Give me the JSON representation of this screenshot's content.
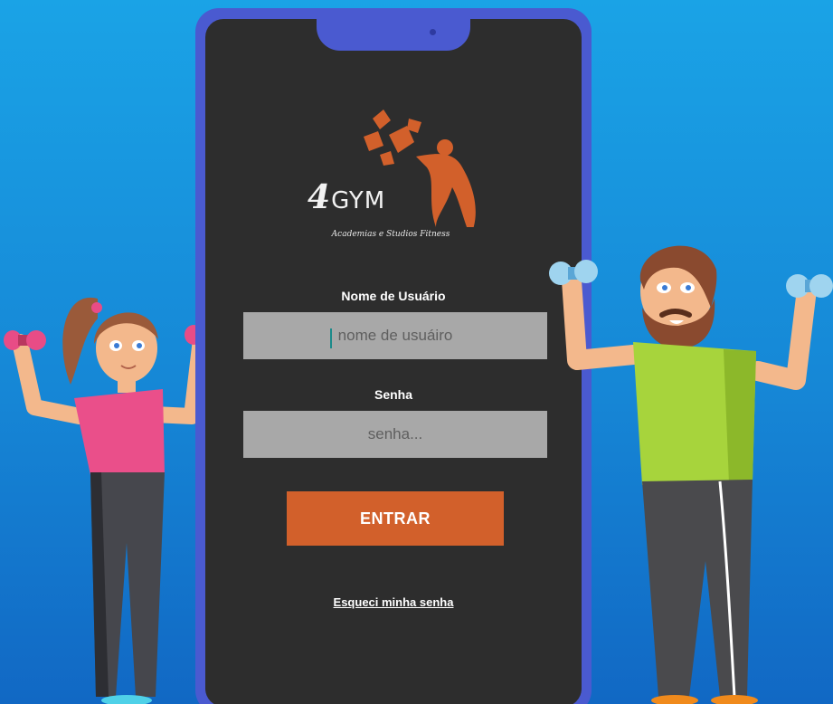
{
  "brand": {
    "logo_word": "GYM",
    "logo_number": "4",
    "tagline": "Academias e Studios Fitness",
    "accent_color": "#d2602b"
  },
  "login_form": {
    "username_label": "Nome de Usuário",
    "username_placeholder": "nome de usuáiro",
    "password_label": "Senha",
    "password_placeholder": "senha...",
    "submit_label": "ENTRAR",
    "forgot_password_link": "Esqueci minha senha"
  },
  "colors": {
    "background_top": "#1aa3e6",
    "background_bottom": "#1168c4",
    "phone_frame": "#4a5ad0",
    "screen": "#2d2d2d",
    "input_fill": "#a8a8a8"
  },
  "illustrations": {
    "left": "woman-lifting-dumbbells",
    "right": "bearded-man-lifting-dumbbells"
  }
}
